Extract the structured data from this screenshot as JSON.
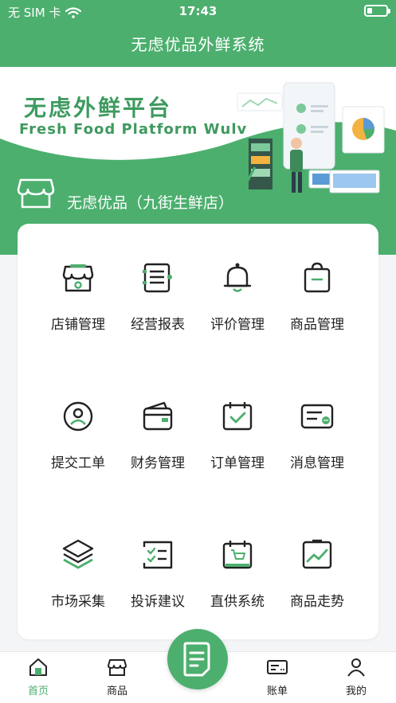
{
  "status_bar": {
    "carrier": "无 SIM 卡",
    "time": "17:43"
  },
  "nav": {
    "title": "无虑优品外鲜系统"
  },
  "banner": {
    "title": "无虑外鲜平台",
    "subtitle": "Fresh Food Platform Wulv",
    "store_name": "无虑优品（九街生鲜店）"
  },
  "menu": [
    {
      "label": "店铺管理",
      "icon": "store-icon"
    },
    {
      "label": "经营报表",
      "icon": "report-icon"
    },
    {
      "label": "评价管理",
      "icon": "bell-icon"
    },
    {
      "label": "商品管理",
      "icon": "shopping-bag-icon"
    },
    {
      "label": "提交工单",
      "icon": "user-circle-icon"
    },
    {
      "label": "财务管理",
      "icon": "wallet-icon"
    },
    {
      "label": "订单管理",
      "icon": "calendar-check-icon"
    },
    {
      "label": "消息管理",
      "icon": "message-icon"
    },
    {
      "label": "市场采集",
      "icon": "layers-icon"
    },
    {
      "label": "投诉建议",
      "icon": "checklist-icon"
    },
    {
      "label": "直供系统",
      "icon": "calendar-cart-icon"
    },
    {
      "label": "商品走势",
      "icon": "trend-chart-icon"
    }
  ],
  "tabbar": {
    "items": [
      {
        "label": "首页",
        "icon": "home-icon",
        "active": true
      },
      {
        "label": "商品",
        "icon": "store-icon"
      },
      {
        "label": "账单",
        "icon": "bill-icon"
      },
      {
        "label": "我的",
        "icon": "person-icon"
      }
    ],
    "center_icon": "document-icon"
  },
  "colors": {
    "brand_green": "#4caf6e",
    "text": "#222222"
  }
}
